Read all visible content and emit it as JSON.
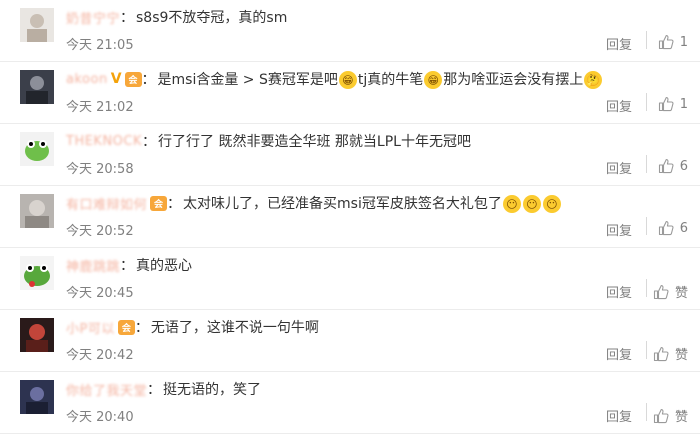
{
  "comments": [
    {
      "user": "奶昔宁宁",
      "badges": [],
      "text": "s8s9不放夺冠，真的sm",
      "time": "今天 21:05",
      "reply": "回复",
      "likes": "1",
      "avatar": "avatar-sketch"
    },
    {
      "user": "akoon",
      "badges": [
        "V",
        "vip"
      ],
      "text": "是msi含金量 > S赛冠军是吧😁tj真的牛笔😁那为啥亚运会没有摆上🤔",
      "time": "今天 21:02",
      "reply": "回复",
      "likes": "1",
      "avatar": "avatar-dark"
    },
    {
      "user": "THEKNOCK",
      "badges": [],
      "text": "行了行了 既然非要造全华班 那就当LPL十年无冠吧",
      "time": "今天 20:58",
      "reply": "回复",
      "likes": "6",
      "avatar": "avatar-frog"
    },
    {
      "user": "有口难辩如何",
      "badges": [
        "vip"
      ],
      "text": "太对味儿了，已经准备买msi冠军皮肤签名大礼包了😶😶😶",
      "time": "今天 20:52",
      "reply": "回复",
      "likes": "6",
      "avatar": "avatar-gray"
    },
    {
      "user": "神鹿跳跳",
      "badges": [],
      "text": "真的恶心",
      "time": "今天 20:45",
      "reply": "回复",
      "likes": "赞",
      "avatar": "avatar-frog2"
    },
    {
      "user": "小P可以",
      "badges": [
        "vip"
      ],
      "text": "无语了，这谁不说一句牛啊",
      "time": "今天 20:42",
      "reply": "回复",
      "likes": "赞",
      "avatar": "avatar-red"
    },
    {
      "user": "你给了我天堂",
      "badges": [],
      "text": "挺无语的，笑了",
      "time": "今天 20:40",
      "reply": "回复",
      "likes": "赞",
      "avatar": "avatar-night"
    }
  ],
  "colors": {
    "username": "#eb7350",
    "meta": "#808080",
    "text": "#333333",
    "vip": "#f7a73a"
  }
}
